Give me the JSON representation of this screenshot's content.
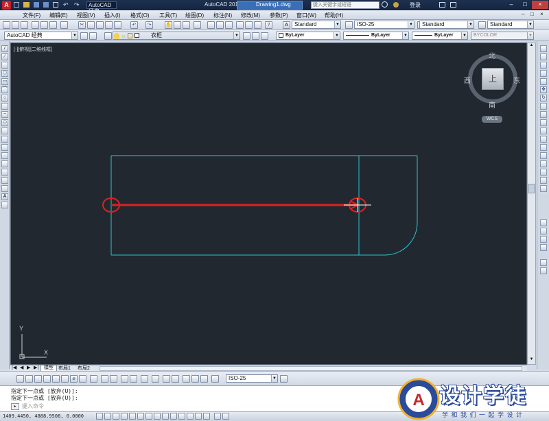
{
  "titlebar": {
    "workspace": "AutoCAD 经典",
    "app_title": "AutoCAD 2013",
    "file_name": "Drawing1.dwg",
    "search_placeholder": "键入关键字或短语",
    "login_label": "登录"
  },
  "menubar": {
    "items": [
      "文件(F)",
      "编辑(E)",
      "视图(V)",
      "插入(I)",
      "格式(O)",
      "工具(T)",
      "绘图(D)",
      "标注(N)",
      "修改(M)",
      "参数(P)",
      "窗口(W)",
      "帮助(H)"
    ]
  },
  "toolbar1": {
    "text_style": "Standard",
    "dim_style": "ISO-25",
    "table_style": "Standard",
    "multileader_style": "Standard"
  },
  "toolbar2": {
    "workspace": "AutoCAD 经典",
    "layer_name": "衣柜",
    "color": "ByLayer",
    "linetype": "ByLayer",
    "lineweight": "ByLayer",
    "plot_style": "BYCOLOR"
  },
  "viewport": {
    "label": "[-][俯视][二维线框]",
    "viewcube": {
      "north": "北",
      "south": "南",
      "east": "东",
      "west": "西",
      "face": "上",
      "wcs": "WCS"
    },
    "ucs": {
      "x": "X",
      "y": "Y"
    }
  },
  "tabs": [
    "模型",
    "布局1",
    "布局2"
  ],
  "toolbar3": {
    "dim_style": "ISO-25"
  },
  "command": {
    "history": [
      "指定下一点或 [放弃(U)]:",
      "指定下一点或 [放弃(U)]:"
    ],
    "input_placeholder": "键入命令"
  },
  "status": {
    "coordinates": "1409.4450, 4888.9508, 0.0000"
  },
  "watermark": {
    "title": "设计学徒",
    "subtitle": "学 和 我 们 一 起 学 设 计"
  },
  "colors": {
    "drawing_line": "#33c3cc",
    "highlight": "#e02020",
    "canvas": "#212830"
  }
}
